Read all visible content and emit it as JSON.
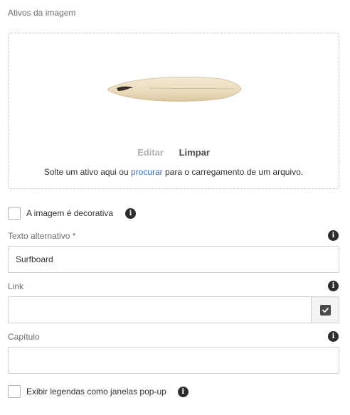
{
  "section_title": "Ativos da imagem",
  "dropzone": {
    "edit_label": "Editar",
    "clear_label": "Limpar",
    "hint_before": "Solte um ativo aqui ou ",
    "hint_link": "procurar",
    "hint_after": " para o carregamento de um arquivo.",
    "image_icon": "surfboard-image"
  },
  "decorative": {
    "label": "A imagem é decorativa",
    "checked": false,
    "icon": "info-icon"
  },
  "alt_text": {
    "label": "Texto alternativo *",
    "value": "Surfboard",
    "icon": "info-icon"
  },
  "link": {
    "label": "Link",
    "value": "",
    "button_icon": "checkbox-check-icon",
    "icon": "info-icon"
  },
  "caption": {
    "label": "Capítulo",
    "value": "",
    "icon": "info-icon"
  },
  "popup": {
    "label": "Exibir legendas como janelas pop-up",
    "checked": false,
    "icon": "info-icon"
  },
  "colors": {
    "link": "#326ec8",
    "disabled": "#b3b3b3",
    "icon": "#2c2c2c"
  }
}
